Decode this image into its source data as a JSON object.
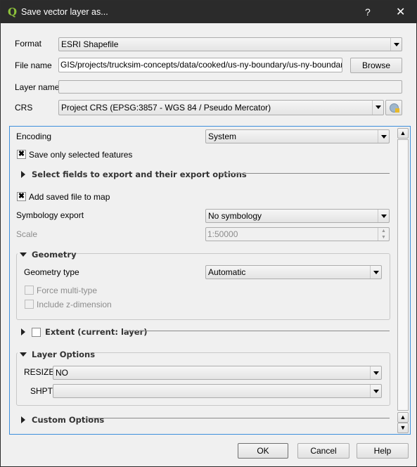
{
  "window": {
    "title": "Save vector layer as...",
    "help_label": "?",
    "close_label": "✕",
    "icon": "qgis-logo-icon"
  },
  "form": {
    "format_label": "Format",
    "format_value": "ESRI Shapefile",
    "filename_label": "File name",
    "filename_value": "GIS/projects/trucksim-concepts/data/cooked/us-ny-boundary/us-ny-boundary.shp",
    "browse_label": "Browse",
    "layername_label": "Layer name",
    "layername_value": "",
    "crs_label": "CRS",
    "crs_value": "Project CRS (EPSG:3857 - WGS 84 / Pseudo Mercator)",
    "crs_button_icon": "globe-select-crs-icon"
  },
  "options": {
    "encoding_label": "Encoding",
    "encoding_value": "System",
    "save_selected_label": "Save only selected features",
    "save_selected_checked": true,
    "select_fields_header": "Select fields to export and their export options",
    "add_to_map_label": "Add saved file to map",
    "add_to_map_checked": true,
    "symbology_label": "Symbology export",
    "symbology_value": "No symbology",
    "scale_label": "Scale",
    "scale_value": "1:50000",
    "geometry": {
      "header": "Geometry",
      "type_label": "Geometry type",
      "type_value": "Automatic",
      "force_multi_label": "Force multi-type",
      "force_multi_checked": false,
      "z_dim_label": "Include z-dimension",
      "z_dim_checked": false
    },
    "extent_header": "Extent (current: layer)",
    "extent_checked": false,
    "layer_options": {
      "header": "Layer Options",
      "resize_label": "RESIZE",
      "resize_value": "NO",
      "shpt_label": "SHPT",
      "shpt_value": ""
    },
    "custom_options_header": "Custom Options"
  },
  "buttons": {
    "ok": "OK",
    "cancel": "Cancel",
    "help": "Help"
  },
  "colors": {
    "titlebar": "#2b2b2b",
    "focus_border": "#3c8fdc",
    "background": "#f0f0f0"
  }
}
